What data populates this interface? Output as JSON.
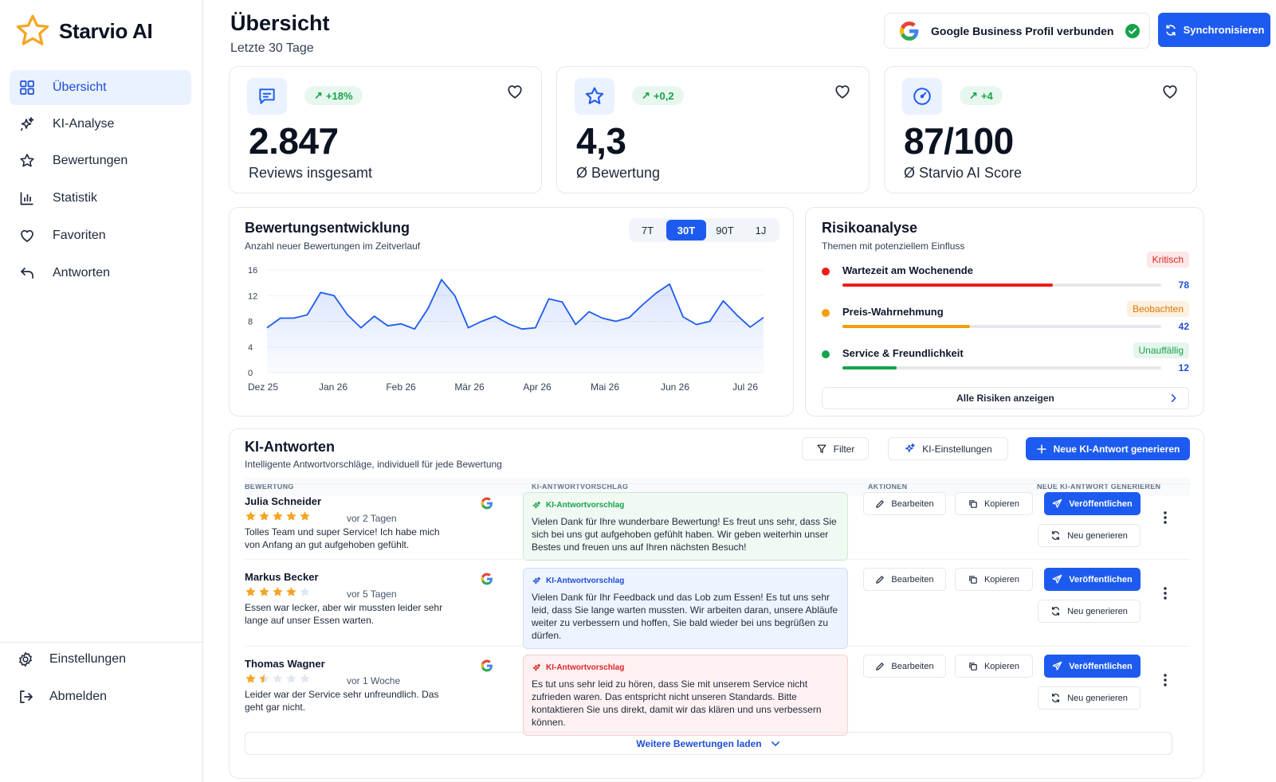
{
  "app": {
    "name": "Starvio AI"
  },
  "sidebar": {
    "items": [
      {
        "label": "Übersicht",
        "icon": "grid-icon",
        "active": true
      },
      {
        "label": "KI-Analyse",
        "icon": "sparkles-icon"
      },
      {
        "label": "Bewertungen",
        "icon": "star-icon"
      },
      {
        "label": "Statistik",
        "icon": "bar-chart-icon"
      },
      {
        "label": "Favoriten",
        "icon": "heart-icon"
      },
      {
        "label": "Antworten",
        "icon": "reply-icon"
      }
    ],
    "bottom": [
      {
        "label": "Einstellungen",
        "icon": "gear-icon"
      },
      {
        "label": "Abmelden",
        "icon": "logout-icon"
      }
    ]
  },
  "header": {
    "title": "Übersicht",
    "subtitle": "Letzte 30 Tage",
    "connection_label": "Google Business Profil verbunden",
    "sync_label": "Synchronisieren"
  },
  "stats": [
    {
      "value": "2.847",
      "label": "Reviews insgesamt",
      "badge": "+18%",
      "icon": "chat-icon"
    },
    {
      "value": "4,3",
      "label": "Ø Bewertung",
      "badge": "+0,2",
      "icon": "star-icon"
    },
    {
      "value": "87/100",
      "label": "Ø Starvio AI Score",
      "badge": "+4",
      "icon": "gauge-icon"
    }
  ],
  "trend": {
    "title": "Bewertungsentwicklung",
    "subtitle": "Anzahl neuer Bewertungen im Zeitverlauf",
    "ranges": [
      "7T",
      "30T",
      "90T",
      "1J"
    ],
    "active_range": "30T"
  },
  "chart_data": {
    "type": "area",
    "title": "Bewertungsentwicklung",
    "xlabel": "",
    "ylabel": "",
    "ylim": [
      0,
      16
    ],
    "yticks": [
      0,
      4,
      8,
      12,
      16
    ],
    "x_tick_labels": [
      "Dez 25",
      "Jan 26",
      "Feb 26",
      "Mär 26",
      "Apr 26",
      "Mai 26",
      "Jun 26",
      "Jul 26"
    ],
    "values": [
      7,
      8.5,
      8.5,
      9,
      12.5,
      12,
      9,
      7,
      8.8,
      7.3,
      7.6,
      6.8,
      10,
      14.5,
      12,
      7,
      8,
      8.8,
      7.6,
      6.8,
      7,
      11.5,
      11,
      7.5,
      9.5,
      8.5,
      8,
      8.6,
      10.6,
      12.4,
      13.8,
      8.7,
      7.5,
      8,
      11.2,
      9,
      7.1,
      8.6
    ],
    "grid": true,
    "legend": "none",
    "line_color": "#1d5bf0"
  },
  "risk": {
    "title": "Risikoanalyse",
    "subtitle": "Themen mit potenziellem Einfluss",
    "items": [
      {
        "name": "Wartezeit am Wochenende",
        "tag": "Kritisch",
        "value": "78",
        "level": 0.66,
        "color": "#ef1c1c",
        "tag_bg": "#fde8e8",
        "tag_color": "#dc2626"
      },
      {
        "name": "Preis-Wahrnehmung",
        "tag": "Beobachten",
        "value": "42",
        "level": 0.4,
        "color": "#f59e0b",
        "tag_bg": "#fdf1df",
        "tag_color": "#d97706"
      },
      {
        "name": "Service & Freundlichkeit",
        "tag": "Unauffällig",
        "value": "12",
        "level": 0.17,
        "color": "#16a34a",
        "tag_bg": "#e6f6ec",
        "tag_color": "#16a34a"
      }
    ],
    "all_label": "Alle Risiken anzeigen"
  },
  "ai": {
    "title": "KI-Antworten",
    "subtitle": "Intelligente Antwortvorschläge, individuell für jede Bewertung",
    "filter_label": "Filter",
    "settings_label": "KI-Einstellungen",
    "new_label": "Neue KI-Antwort generieren",
    "columns": [
      "BEWERTUNG",
      "KI-ANTWORTVORSCHLAG",
      "AKTIONEN",
      "NEUE KI-ANTWORT GENERIEREN"
    ],
    "suggestion_tag": "KI-Antwortvorschlag",
    "edit_label": "Bearbeiten",
    "copy_label": "Kopieren",
    "publish_label": "Veröffentlichen",
    "regen_label": "Neu generieren",
    "load_more": "Weitere Bewertungen laden",
    "reviews": [
      {
        "name": "Julia Schneider",
        "stars": 5,
        "time": "vor 2 Tagen",
        "text": "Tolles Team und super Service! Ich habe mich von Anfang an gut aufgehoben gefühlt.",
        "tone": "green",
        "suggestion": "Vielen Dank für Ihre wunderbare Bewertung! Es freut uns sehr, dass Sie sich bei uns gut aufgehoben gefühlt haben. Wir geben weiterhin unser Bestes und freuen uns auf Ihren nächsten Besuch!"
      },
      {
        "name": "Markus Becker",
        "stars": 4,
        "time": "vor 5 Tagen",
        "text": "Essen war lecker, aber wir mussten leider sehr lange auf unser Essen warten.",
        "tone": "blue",
        "suggestion": "Vielen Dank für Ihr Feedback und das Lob zum Essen! Es tut uns sehr leid, dass Sie lange warten mussten. Wir arbeiten daran, unsere Abläufe weiter zu verbessern und hoffen, Sie bald wieder bei uns begrüßen zu dürfen."
      },
      {
        "name": "Thomas Wagner",
        "stars": 1.5,
        "time": "vor 1 Woche",
        "text": "Leider war der Service sehr unfreundlich. Das geht gar nicht.",
        "tone": "red",
        "suggestion": "Es tut uns sehr leid zu hören, dass Sie mit unserem Service nicht zufrieden waren. Das entspricht nicht unseren Standards. Bitte kontaktieren Sie uns direkt, damit wir das klären und uns verbessern können."
      }
    ]
  }
}
